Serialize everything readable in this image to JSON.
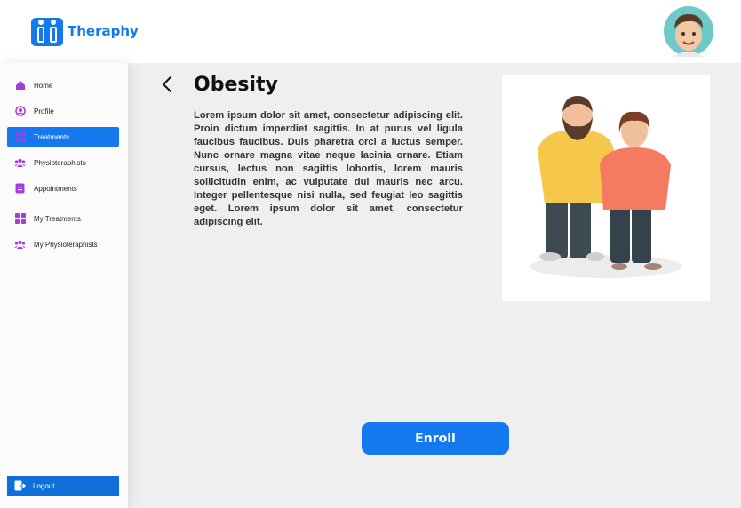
{
  "brand": {
    "name": "Theraphy"
  },
  "sidebar": {
    "items": [
      {
        "label": "Home",
        "icon": "home-icon",
        "active": false
      },
      {
        "label": "Profile",
        "icon": "profile-icon",
        "active": false
      },
      {
        "label": "Treatments",
        "icon": "grid-icon",
        "active": true
      },
      {
        "label": "Physioteraphists",
        "icon": "users-icon",
        "active": false
      },
      {
        "label": "Appointments",
        "icon": "calendar-icon",
        "active": false
      },
      {
        "label": "My Treatments",
        "icon": "grid-icon",
        "active": false
      },
      {
        "label": "My Physioteraphists",
        "icon": "users-icon",
        "active": false
      }
    ],
    "logout_label": "Logout"
  },
  "main": {
    "title": "Obesity",
    "description": "Lorem ipsum dolor sit amet, consectetur adipiscing elit. Proin dictum imperdiet sagittis. In at purus vel ligula faucibus faucibus. Duis pharetra orci a luctus semper. Nunc ornare magna vitae neque lacinia ornare. Etiam cursus, lectus non sagittis lobortis, lorem mauris sollicitudin enim, ac vulputate dui mauris nec arcu. Integer pellentesque nisi nulla, sed feugiat leo sagittis eget. Lorem ipsum dolor sit amet, consectetur adipiscing elit.",
    "enroll_label": "Enroll"
  },
  "colors": {
    "accent": "#1478ef",
    "icon": "#a83be0"
  }
}
